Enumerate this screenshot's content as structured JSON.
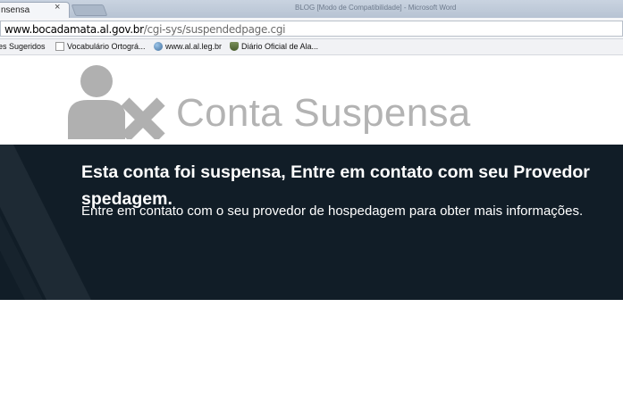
{
  "browser": {
    "active_tab_title": "nsensa",
    "close_glyph": "×",
    "window_title": "BLOG [Modo de Compatibilidade] - Microsoft Word",
    "url": {
      "host": "www.bocadamata.al.gov.br",
      "path": "/cgi-sys/suspendedpage.cgi"
    },
    "bookmarks": [
      {
        "label": "es Sugeridos",
        "icon": "none"
      },
      {
        "label": "Vocabulário Ortográ...",
        "icon": "page-icon"
      },
      {
        "label": "www.al.al.leg.br",
        "icon": "globe-icon"
      },
      {
        "label": "Diário Oficial de Ala...",
        "icon": "shield-icon"
      }
    ]
  },
  "page": {
    "logo_icon": "user-suspended-icon",
    "title": "Conta Suspensa",
    "heading": "Esta conta foi suspensa, Entre em contato com seu Provedor de Hospedagem.",
    "heading_visible_line1": "Esta conta foi suspensa, Entre em contato com seu Provedor",
    "heading_visible_line2": "spedagem.",
    "message": "Entre em contato com o seu provedor de hospedagem para obter mais informações."
  },
  "colors": {
    "banner_bg": "#111d27",
    "title_gray": "#b3b3b3",
    "icon_gray": "#b0b0b0"
  }
}
